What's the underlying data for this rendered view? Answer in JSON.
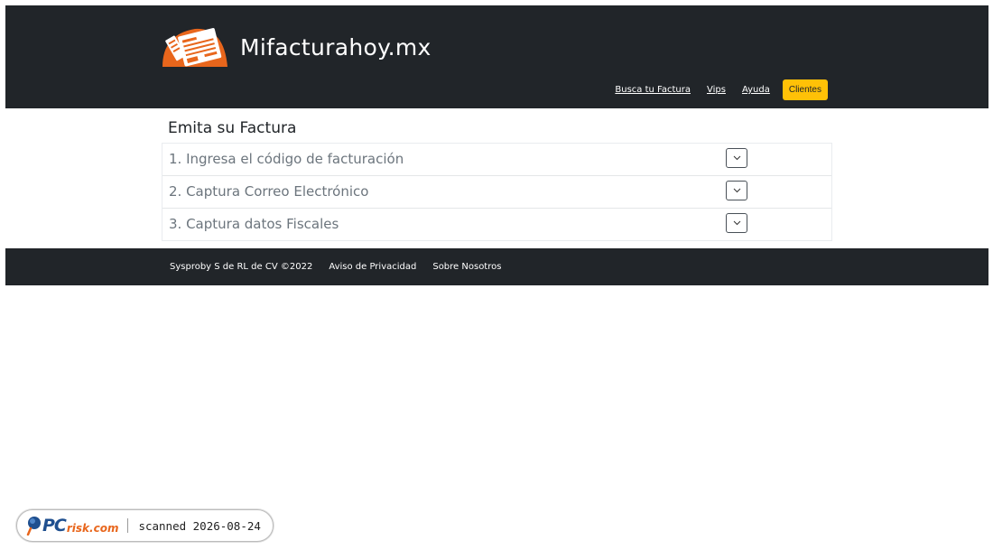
{
  "header": {
    "site_title": "Mifacturahoy.mx",
    "nav": [
      {
        "label": "Busca tu Factura"
      },
      {
        "label": "Vips"
      },
      {
        "label": "Ayuda"
      }
    ],
    "cta_label": "Clientes"
  },
  "main": {
    "title": "Emita su Factura",
    "steps": [
      {
        "label": "1. Ingresa el código de facturación",
        "icon": "chevron-down-icon"
      },
      {
        "label": "2. Captura Correo Electrónico",
        "icon": "chevron-down-icon"
      },
      {
        "label": "3. Captura datos Fiscales",
        "icon": "chevron-down-icon"
      }
    ]
  },
  "footer": {
    "copyright": "Sysproby S de RL de CV ©2022",
    "links": [
      {
        "label": "Aviso de Privacidad"
      },
      {
        "label": "Sobre Nosotros"
      }
    ]
  },
  "badge": {
    "logo_mark": "PC",
    "logo_site": "risk.com",
    "scan_text": "scanned 2026-08-24"
  },
  "colors": {
    "header_bg": "#212529",
    "accent": "#ffc107",
    "logo_orange": "#e8661c",
    "muted_text": "#6c757d"
  }
}
